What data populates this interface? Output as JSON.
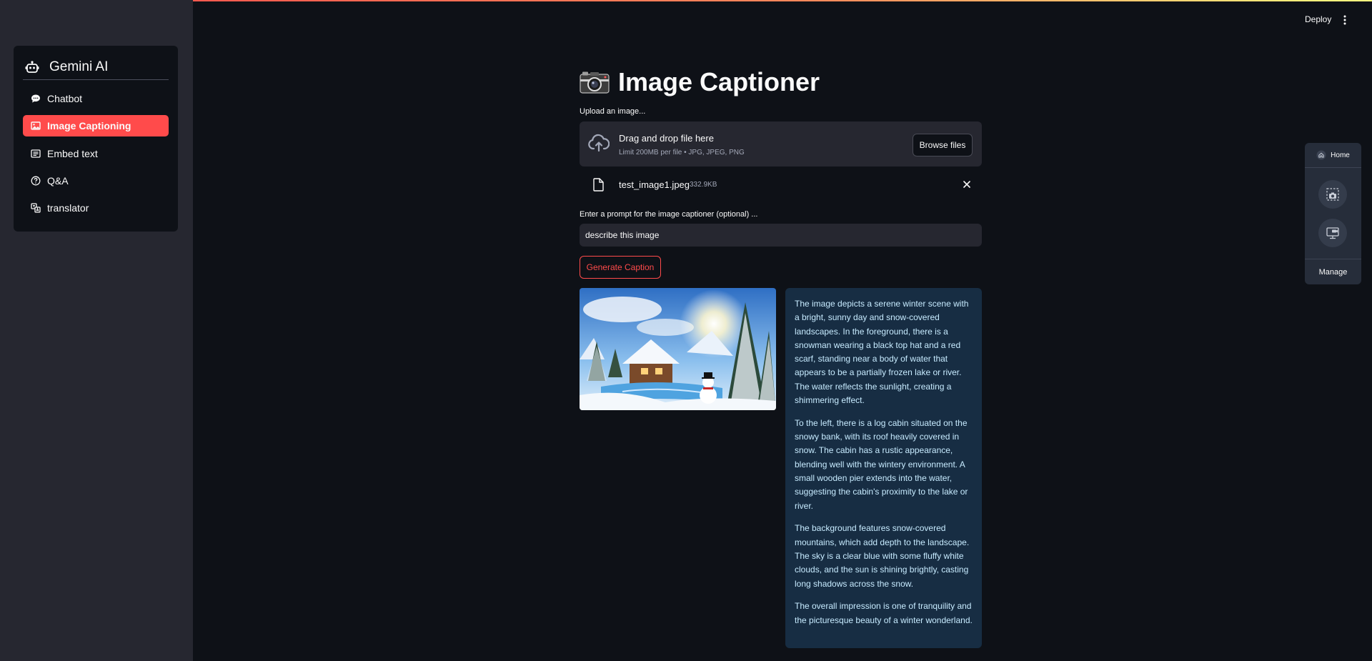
{
  "sidebar": {
    "title": "Gemini AI",
    "items": [
      {
        "label": "Chatbot",
        "icon": "chat-bubble-icon",
        "active": false
      },
      {
        "label": "Image Captioning",
        "icon": "image-icon",
        "active": true
      },
      {
        "label": "Embed text",
        "icon": "text-lines-icon",
        "active": false
      },
      {
        "label": "Q&A",
        "icon": "question-circle-icon",
        "active": false
      },
      {
        "label": "translator",
        "icon": "translate-icon",
        "active": false
      }
    ]
  },
  "header": {
    "deploy_label": "Deploy",
    "menu_icon": "kebab-menu-icon"
  },
  "main": {
    "title_icon": "camera-icon",
    "title": "Image Captioner",
    "uploader": {
      "label": "Upload an image...",
      "dropzone_text": "Drag and drop file here",
      "limit_text": "Limit 200MB per file • JPG, JPEG, PNG",
      "browse_label": "Browse files"
    },
    "uploaded_file": {
      "name": "test_image1.jpeg",
      "size": "332.9KB"
    },
    "prompt": {
      "label": "Enter a prompt for the image captioner (optional) ...",
      "value": "describe this image"
    },
    "generate_label": "Generate Caption",
    "caption_paragraphs": [
      "The image depicts a serene winter scene with a bright, sunny day and snow-covered landscapes. In the foreground, there is a snowman wearing a black top hat and a red scarf, standing near a body of water that appears to be a partially frozen lake or river. The water reflects the sunlight, creating a shimmering effect.",
      "To the left, there is a log cabin situated on the snowy bank, with its roof heavily covered in snow. The cabin has a rustic appearance, blending well with the wintery environment. A small wooden pier extends into the water, suggesting the cabin's proximity to the lake or river.",
      "The background features snow-covered mountains, which add depth to the landscape. The sky is a clear blue with some fluffy white clouds, and the sun is shining brightly, casting long shadows across the snow.",
      "The overall impression is one of tranquility and the picturesque beauty of a winter wonderland."
    ]
  },
  "side_panel": {
    "home_label": "Home",
    "manage_label": "Manage"
  },
  "colors": {
    "accent": "#ff4b4b",
    "background": "#0e1117",
    "sidebar": "#262730",
    "caption_bg": "#172d43",
    "caption_text": "#c7ebff"
  }
}
